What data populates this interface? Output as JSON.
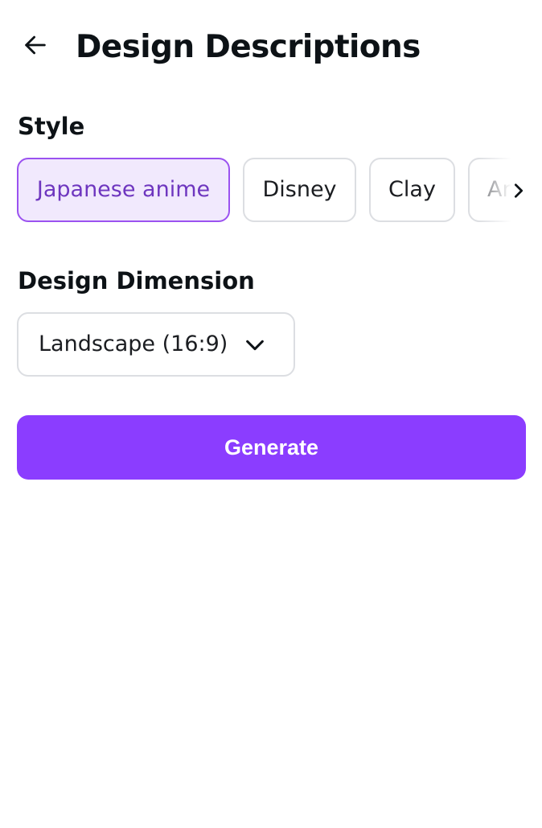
{
  "header": {
    "title": "Design Descriptions"
  },
  "style": {
    "label": "Style",
    "options": [
      {
        "label": "Japanese anime",
        "selected": true
      },
      {
        "label": "Disney",
        "selected": false
      },
      {
        "label": "Clay",
        "selected": false
      },
      {
        "label": "An",
        "selected": false
      }
    ]
  },
  "dimension": {
    "label": "Design Dimension",
    "selected": "Landscape (16:9)"
  },
  "actions": {
    "generate_label": "Generate"
  },
  "colors": {
    "accent": "#8b3dff",
    "selected_border": "#9b52f0",
    "selected_background": "#f1e9fd",
    "selected_text": "#6e36bf"
  },
  "icons": {
    "back": "arrow-left-icon",
    "scroll": "chevron-right-icon",
    "dropdown": "chevron-down-icon"
  }
}
